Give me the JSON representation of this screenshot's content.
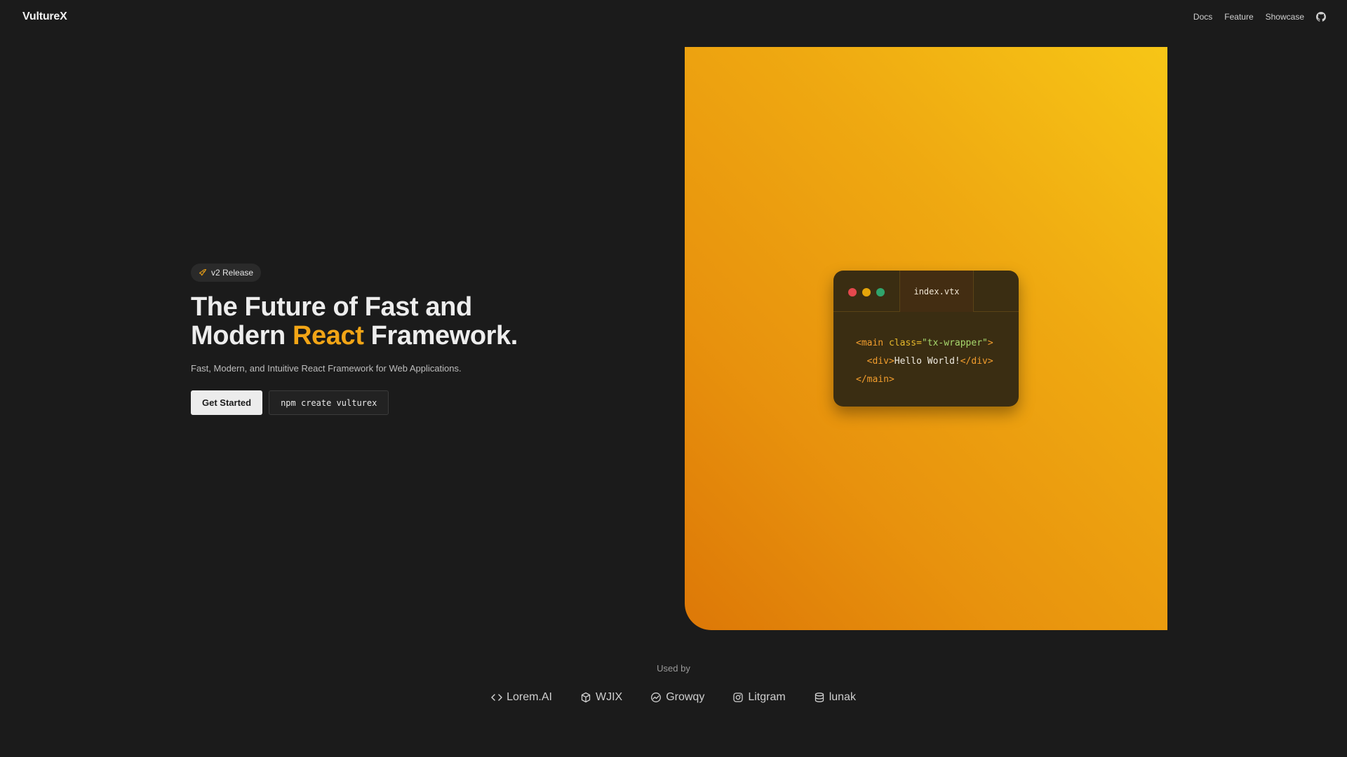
{
  "header": {
    "brand": "VultureX",
    "nav": [
      {
        "label": "Docs"
      },
      {
        "label": "Feature"
      },
      {
        "label": "Showcase"
      }
    ],
    "github_icon": "github-icon"
  },
  "hero": {
    "badge": "v2 Release",
    "badge_icon": "rocket-icon",
    "headline_part1": "The Future of Fast and",
    "headline_part2": "Modern ",
    "headline_accent": "React",
    "headline_part3": " Framework.",
    "subline": "Fast, Modern, and Intuitive React Framework for Web Applications.",
    "primary_cta": "Get Started",
    "code_cta": "npm create vulturex",
    "accent_color": "#f2a516"
  },
  "code_window": {
    "tab": "index.vtx",
    "lines": [
      {
        "t1": "<main ",
        "a": "class=",
        "s": "\"tx-wrapper\"",
        "t2": ">"
      },
      {
        "indent": "  ",
        "t1": "<div>",
        "txt": "Hello World!",
        "t2": "</div>"
      },
      {
        "t1": "</main>"
      }
    ]
  },
  "used_by": {
    "title": "Used by",
    "companies": [
      {
        "name": "Lorem.AI",
        "icon": "code-brackets-icon"
      },
      {
        "name": "WJIX",
        "icon": "box-icon"
      },
      {
        "name": "Growqy",
        "icon": "trend-circle-icon"
      },
      {
        "name": "Litgram",
        "icon": "instagram-icon"
      },
      {
        "name": "lunak",
        "icon": "database-icon"
      }
    ]
  }
}
